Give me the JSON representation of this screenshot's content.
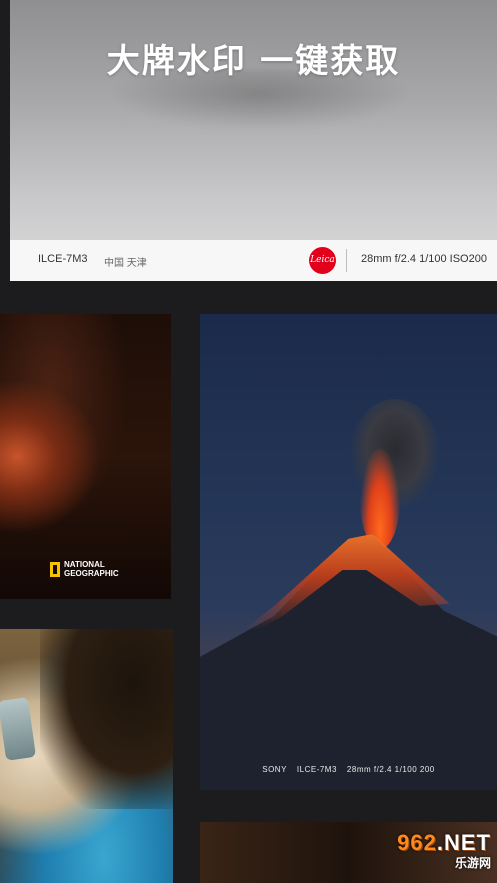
{
  "hero": {
    "title": "大牌水印 一键获取",
    "camera_model": "ILCE-7M3",
    "location": "中国 天津",
    "brand_logo_text": "Leica",
    "brand_color": "#e2001a",
    "exif": "28mm f/2.4 1/100 ISO200"
  },
  "cards": {
    "canyon": {
      "logo_line1": "NATIONAL",
      "logo_line2": "GEOGRAPHIC",
      "logo_color": "#f5c400"
    },
    "volcano": {
      "brand": "SONY",
      "model": "ILCE-7M3",
      "exif": "28mm f/2.4 1/100 200"
    }
  },
  "watermark": {
    "main_prefix": "962",
    "main_suffix": ".NET",
    "sub": "乐游网"
  }
}
